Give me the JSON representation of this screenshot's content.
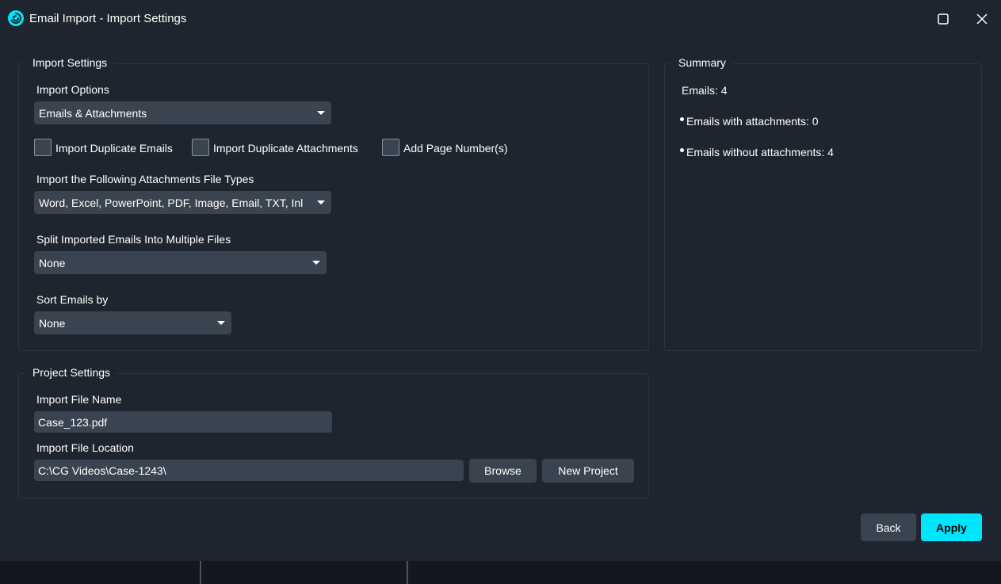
{
  "window": {
    "title": "Email Import - Import Settings",
    "icons": {
      "app": "swirl-logo-icon",
      "maximize": "maximize-icon",
      "close": "close-icon"
    }
  },
  "import_settings": {
    "group_title": "Import Settings",
    "import_options_label": "Import Options",
    "import_options_value": "Emails & Attachments",
    "checkboxes": [
      {
        "label": "Import Duplicate Emails",
        "checked": false
      },
      {
        "label": "Import Duplicate Attachments",
        "checked": false
      },
      {
        "label": "Add Page Number(s)",
        "checked": false
      }
    ],
    "file_types_label": "Import the Following Attachments File Types",
    "file_types_value": "Word, Excel, PowerPoint, PDF, Image, Email, TXT, Inl",
    "split_label": "Split Imported Emails Into Multiple Files",
    "split_value": "None",
    "sort_label": "Sort Emails by",
    "sort_value": "None"
  },
  "summary": {
    "group_title": "Summary",
    "emails": "Emails: 4",
    "with_attachments": "Emails with attachments: 0",
    "without_attachments": "Emails without attachments: 4"
  },
  "project_settings": {
    "group_title": "Project Settings",
    "file_name_label": "Import File Name",
    "file_name_value": "Case_123.pdf",
    "file_location_label": "Import File Location",
    "file_location_value": "C:\\CG Videos\\Case-1243\\",
    "browse_label": "Browse",
    "new_project_label": "New Project"
  },
  "footer": {
    "back_label": "Back",
    "apply_label": "Apply"
  },
  "colors": {
    "background": "#1f252e",
    "control": "#3a4350",
    "accent": "#00e5ff"
  }
}
